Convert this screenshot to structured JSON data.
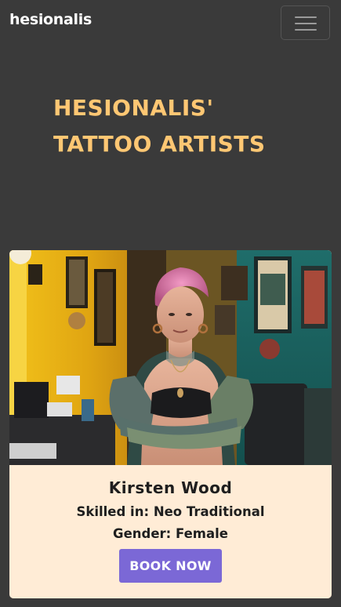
{
  "navbar": {
    "brand": "hesionalis",
    "toggler_icon": "hamburger-menu-icon"
  },
  "page": {
    "title": "HESIONALIS' TATTOO ARTISTS"
  },
  "artist_card": {
    "photo_description_icon": "artist-photo",
    "name": "Kirsten Wood",
    "skill_label": "Skilled in:",
    "skill_value": "Neo Traditional",
    "gender_label": "Gender:",
    "gender_value": "Female",
    "book_label": "BOOK NOW"
  },
  "colors": {
    "background": "#3a3a3a",
    "title": "#ffc773",
    "card_body": "#ffecd6",
    "button": "#7b68d6",
    "text_dark": "#1e1e1e",
    "brand_text": "#ffffff"
  }
}
